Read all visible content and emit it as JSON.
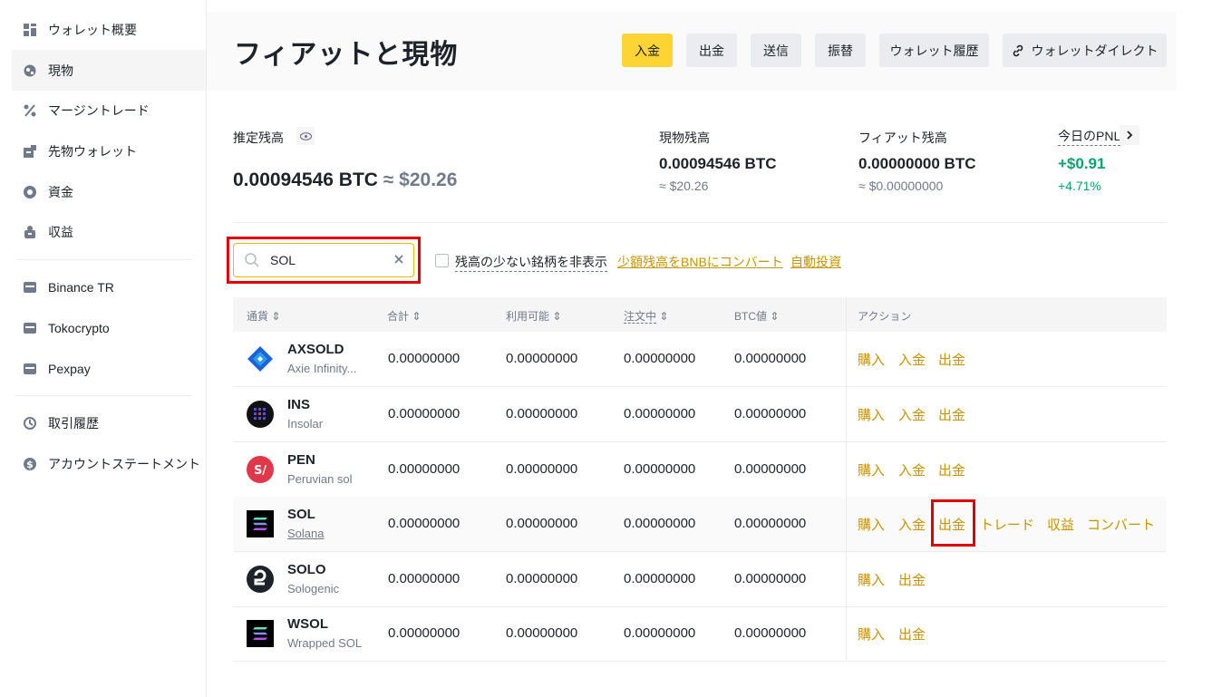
{
  "sidebar": {
    "items": [
      {
        "label": "ウォレット概要",
        "icon": "wallet-overview-icon"
      },
      {
        "label": "現物",
        "icon": "spot-icon"
      },
      {
        "label": "マージントレード",
        "icon": "margin-icon"
      },
      {
        "label": "先物ウォレット",
        "icon": "futures-icon"
      },
      {
        "label": "資金",
        "icon": "funding-icon"
      },
      {
        "label": "収益",
        "icon": "earn-icon"
      }
    ],
    "partners": [
      {
        "label": "Binance TR",
        "icon": "wallet-icon"
      },
      {
        "label": "Tokocrypto",
        "icon": "wallet-icon"
      },
      {
        "label": "Pexpay",
        "icon": "wallet-icon"
      }
    ],
    "history": [
      {
        "label": "取引履歴",
        "icon": "history-icon"
      },
      {
        "label": "アカウントステートメント",
        "icon": "statement-icon"
      }
    ]
  },
  "header": {
    "title": "フィアットと現物",
    "buttons": [
      "入金",
      "出金",
      "送信",
      "振替",
      "ウォレット履歴",
      "ウォレットダイレクト"
    ]
  },
  "balances": {
    "estimated_label": "推定残高",
    "estimated_btc": "0.00094546 BTC",
    "estimated_usd": "≈ $20.26",
    "spot_label": "現物残高",
    "spot_btc": "0.00094546 BTC",
    "spot_usd": "≈ $20.26",
    "fiat_label": "フィアット残高",
    "fiat_btc": "0.00000000 BTC",
    "fiat_usd": "≈ $0.00000000",
    "pnl_label": "今日のPNL",
    "pnl_value": "+$0.91",
    "pnl_pct": "+4.71%"
  },
  "filters": {
    "search_value": "SOL",
    "hide_small_label": "残高の少ない銘柄を非表示",
    "convert_link": "少額残高をBNBにコンバート",
    "auto_invest_link": "自動投資"
  },
  "table": {
    "headers": [
      "通貨",
      "合計",
      "利用可能",
      "注文中",
      "BTC値",
      "アクション"
    ],
    "rows": [
      {
        "symbol": "AXSOLD",
        "name": "Axie Infinity...",
        "total": "0.00000000",
        "available": "0.00000000",
        "in_order": "0.00000000",
        "btc_value": "0.00000000",
        "actions": [
          "購入",
          "入金",
          "出金"
        ]
      },
      {
        "symbol": "INS",
        "name": "Insolar",
        "total": "0.00000000",
        "available": "0.00000000",
        "in_order": "0.00000000",
        "btc_value": "0.00000000",
        "actions": [
          "購入",
          "入金",
          "出金"
        ]
      },
      {
        "symbol": "PEN",
        "name": "Peruvian sol",
        "total": "0.00000000",
        "available": "0.00000000",
        "in_order": "0.00000000",
        "btc_value": "0.00000000",
        "actions": [
          "購入",
          "入金",
          "出金"
        ]
      },
      {
        "symbol": "SOL",
        "name": "Solana",
        "total": "0.00000000",
        "available": "0.00000000",
        "in_order": "0.00000000",
        "btc_value": "0.00000000",
        "actions": [
          "購入",
          "入金",
          "出金",
          "トレード",
          "収益",
          "コンバート"
        ]
      },
      {
        "symbol": "SOLO",
        "name": "Sologenic",
        "total": "0.00000000",
        "available": "0.00000000",
        "in_order": "0.00000000",
        "btc_value": "0.00000000",
        "actions": [
          "購入",
          "出金"
        ]
      },
      {
        "symbol": "WSOL",
        "name": "Wrapped SOL",
        "total": "0.00000000",
        "available": "0.00000000",
        "in_order": "0.00000000",
        "btc_value": "0.00000000",
        "actions": [
          "購入",
          "出金"
        ]
      }
    ]
  },
  "colors": {
    "accent": "#fcd535",
    "link": "#c99400",
    "positive": "#03a66d",
    "highlight": "#e00000"
  }
}
